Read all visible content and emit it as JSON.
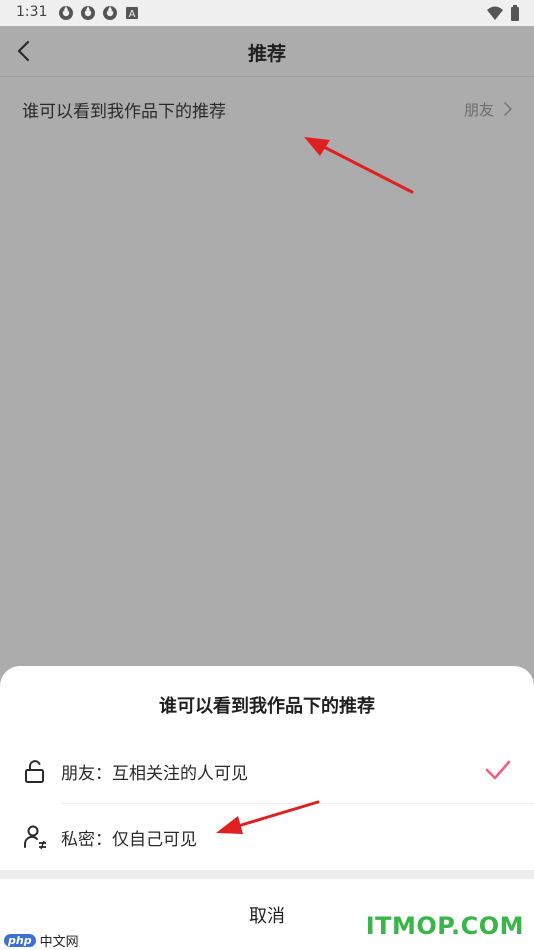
{
  "status_bar": {
    "time": "1:31",
    "notification_icons": [
      "sync-icon",
      "sync-icon",
      "sync-icon",
      "a-badge-icon"
    ],
    "right_icons": [
      "wifi-icon",
      "battery-icon"
    ]
  },
  "header": {
    "back_icon": "chevron-left-icon",
    "title": "推荐"
  },
  "setting_row": {
    "label": "谁可以看到我作品下的推荐",
    "value": "朋友",
    "chevron_icon": "chevron-right-icon"
  },
  "sheet": {
    "title": "谁可以看到我作品下的推荐",
    "options": [
      {
        "icon": "unlock-icon",
        "label": "朋友：互相关注的人可见",
        "selected": true
      },
      {
        "icon": "person-private-icon",
        "label": "私密：仅自己可见",
        "selected": false
      }
    ],
    "cancel_label": "取消"
  },
  "watermarks": {
    "left_badge": "php",
    "left_text": "中文网",
    "right_text": "ITMOP.COM"
  },
  "colors": {
    "overlay": "#acacac",
    "accent_check": "#f0607d",
    "arrow_red": "#e02020",
    "watermark_green": "#39b54a"
  }
}
